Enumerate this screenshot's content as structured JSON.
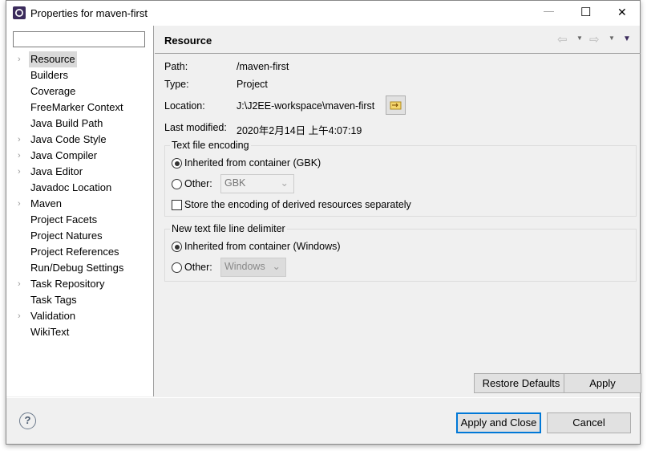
{
  "window": {
    "title": "Properties for maven-first",
    "controls": {
      "minimize": "—",
      "maximize": "☐",
      "close": "✕"
    }
  },
  "sidebar": {
    "filter_value": "",
    "items": [
      {
        "label": "Resource",
        "expandable": true,
        "selected": true
      },
      {
        "label": "Builders",
        "expandable": false
      },
      {
        "label": "Coverage",
        "expandable": false
      },
      {
        "label": "FreeMarker Context",
        "expandable": false
      },
      {
        "label": "Java Build Path",
        "expandable": false
      },
      {
        "label": "Java Code Style",
        "expandable": true
      },
      {
        "label": "Java Compiler",
        "expandable": true
      },
      {
        "label": "Java Editor",
        "expandable": true
      },
      {
        "label": "Javadoc Location",
        "expandable": false
      },
      {
        "label": "Maven",
        "expandable": true
      },
      {
        "label": "Project Facets",
        "expandable": false
      },
      {
        "label": "Project Natures",
        "expandable": false
      },
      {
        "label": "Project References",
        "expandable": false
      },
      {
        "label": "Run/Debug Settings",
        "expandable": false
      },
      {
        "label": "Task Repository",
        "expandable": true
      },
      {
        "label": "Task Tags",
        "expandable": false
      },
      {
        "label": "Validation",
        "expandable": true
      },
      {
        "label": "WikiText",
        "expandable": false
      }
    ]
  },
  "page": {
    "title": "Resource",
    "path_label": "Path:",
    "path": "/maven-first",
    "type_label": "Type:",
    "type": "Project",
    "location_label": "Location:",
    "location": "J:\\J2EE-workspace\\maven-first",
    "modified_label": "Last modified:",
    "modified": "2020年2月14日 上午4:07:19",
    "encoding": {
      "title": "Text file encoding",
      "inherited": "Inherited from container (GBK)",
      "other": "Other:",
      "other_value": "GBK",
      "store": "Store the encoding of derived resources separately",
      "selected": "inherited",
      "store_checked": false
    },
    "delimiter": {
      "title": "New text file line delimiter",
      "inherited": "Inherited from container (Windows)",
      "other": "Other:",
      "other_value": "Windows",
      "selected": "inherited"
    },
    "restore_defaults": "Restore Defaults",
    "apply": "Apply"
  },
  "footer": {
    "apply_close": "Apply and Close",
    "cancel": "Cancel",
    "help": "?"
  }
}
